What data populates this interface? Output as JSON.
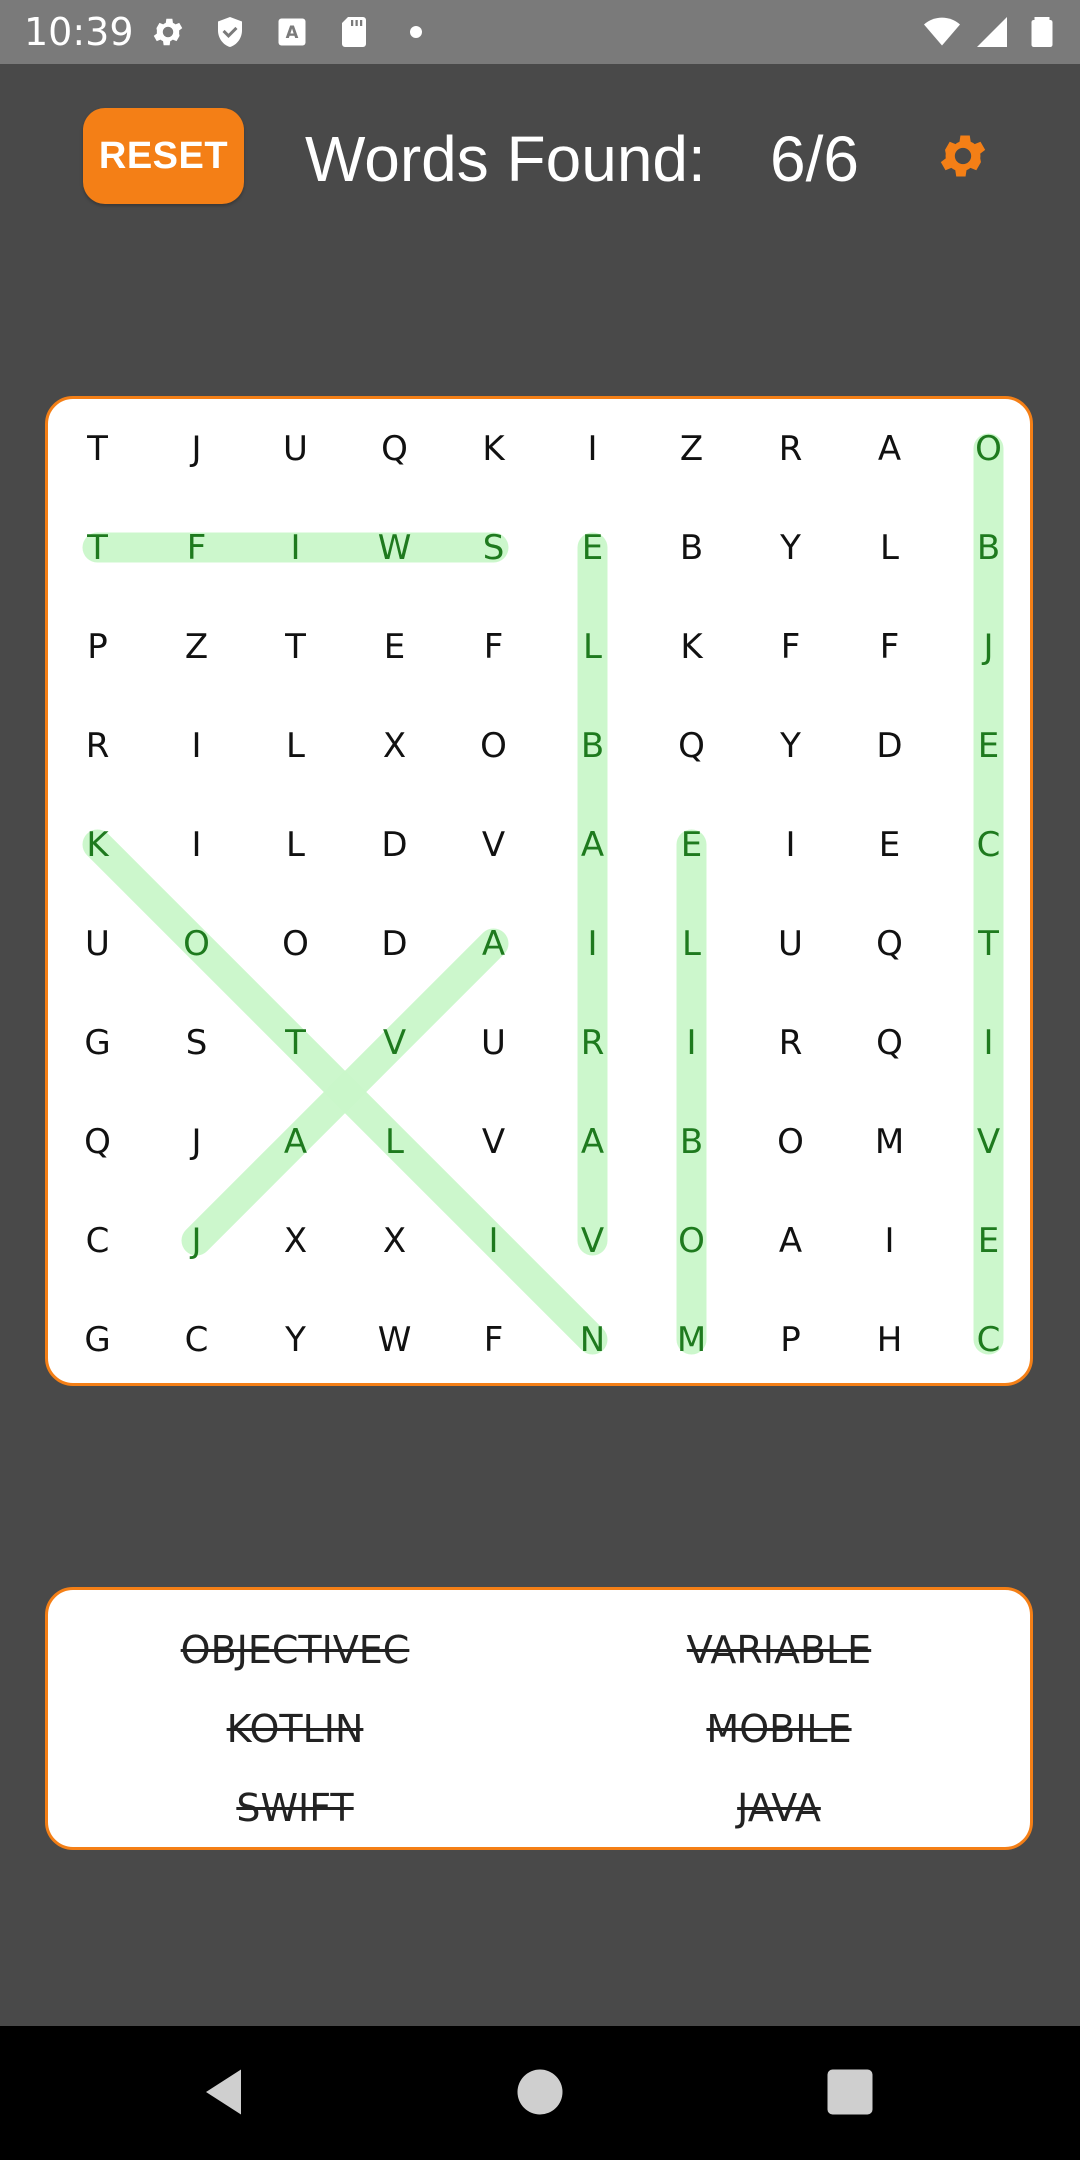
{
  "status_bar": {
    "time": "10:39",
    "left_icons": [
      "gear-icon",
      "shield-icon",
      "a-box-icon",
      "sd-card-icon",
      "dot-icon"
    ],
    "right_icons": [
      "wifi-icon",
      "cell-signal-icon",
      "battery-icon"
    ]
  },
  "header": {
    "reset_label": "RESET",
    "words_found_label": "Words Found:",
    "words_found_count": "6/6",
    "settings_icon": "gear-icon"
  },
  "colors": {
    "accent": "#f47f16",
    "background": "#494949",
    "highlight": "#c9f7c9",
    "found_letter": "#1e7a1e"
  },
  "grid": {
    "rows": [
      [
        "T",
        "J",
        "U",
        "Q",
        "K",
        "I",
        "Z",
        "R",
        "A",
        "O"
      ],
      [
        "T",
        "F",
        "I",
        "W",
        "S",
        "E",
        "B",
        "Y",
        "L",
        "B"
      ],
      [
        "P",
        "Z",
        "T",
        "E",
        "F",
        "L",
        "K",
        "F",
        "F",
        "J"
      ],
      [
        "R",
        "I",
        "L",
        "X",
        "O",
        "B",
        "Q",
        "Y",
        "D",
        "E"
      ],
      [
        "K",
        "I",
        "L",
        "D",
        "V",
        "A",
        "E",
        "I",
        "E",
        "C"
      ],
      [
        "U",
        "O",
        "O",
        "D",
        "A",
        "I",
        "L",
        "U",
        "Q",
        "T"
      ],
      [
        "G",
        "S",
        "T",
        "V",
        "U",
        "R",
        "I",
        "R",
        "Q",
        "I"
      ],
      [
        "Q",
        "J",
        "A",
        "L",
        "V",
        "A",
        "B",
        "O",
        "M",
        "V"
      ],
      [
        "C",
        "J",
        "X",
        "X",
        "I",
        "V",
        "O",
        "A",
        "I",
        "E"
      ],
      [
        "G",
        "C",
        "Y",
        "W",
        "F",
        "N",
        "M",
        "P",
        "H",
        "C"
      ]
    ],
    "found_paths": [
      {
        "word": "OBJECTIVEC",
        "from": [
          0,
          9
        ],
        "to": [
          9,
          9
        ]
      },
      {
        "word": "SWIFT",
        "from": [
          1,
          4
        ],
        "to": [
          1,
          0
        ]
      },
      {
        "word": "VARIABLE",
        "from": [
          8,
          5
        ],
        "to": [
          1,
          5
        ]
      },
      {
        "word": "MOBILE",
        "from": [
          9,
          6
        ],
        "to": [
          4,
          6
        ]
      },
      {
        "word": "KOTLIN",
        "from": [
          4,
          0
        ],
        "to": [
          9,
          5
        ]
      },
      {
        "word": "JAVA",
        "from": [
          8,
          1
        ],
        "to": [
          5,
          4
        ]
      }
    ]
  },
  "word_list": [
    {
      "label": "OBJECTIVEC",
      "found": true
    },
    {
      "label": "VARIABLE",
      "found": true
    },
    {
      "label": "KOTLIN",
      "found": true
    },
    {
      "label": "MOBILE",
      "found": true
    },
    {
      "label": "SWIFT",
      "found": true
    },
    {
      "label": "JAVA",
      "found": true
    }
  ],
  "nav_bar": {
    "icons": [
      "back-icon",
      "home-icon",
      "recents-icon"
    ]
  }
}
